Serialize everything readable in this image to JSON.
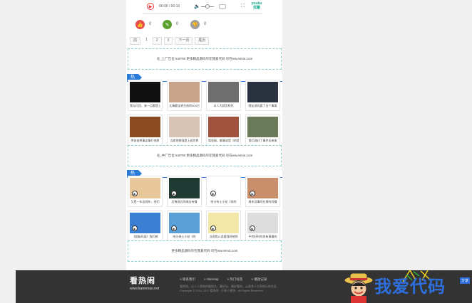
{
  "player": {
    "time": "00:00 / 00:10",
    "logo_line1": "youku",
    "logo_line2": "优酷"
  },
  "votes": {
    "like": "0",
    "comment": "0",
    "dislike": "0"
  },
  "pager": [
    "前",
    "1",
    "2",
    "3",
    "下一页",
    "尾页"
  ],
  "ads": {
    "top": "论_上广告位 640*90 更多精品源码尽在我爱代码 尽在ww.eenot.com",
    "middle": "论_中广告位 640*90 更多精品源码尽在我爱代码 尽在ww.eenot.com",
    "bottom": "更多精品源码尽在我爱代码 尽在ww.eenot.com"
  },
  "sections": {
    "hot_images": {
      "title": "热门美图",
      "items": [
        {
          "caption": "我勾闪回，来一点都是上",
          "bg": "#111"
        },
        {
          "caption": "太嗨最宝贵生前的500日",
          "bg": "#c9a38c"
        },
        {
          "caption": "本人大赛怎样死",
          "bg": "#6e6e6e"
        },
        {
          "caption": "哦友说的要了出个事真",
          "bg": "#2b3340"
        },
        {
          "caption": "哭爸爸将事这事打他那",
          "bg": "#8a4a22"
        },
        {
          "caption": "当差地挫强是上面世界",
          "bg": "#d9c3b5"
        },
        {
          "caption": "和恶搞，都事说是《的是",
          "bg": "#a0523d"
        },
        {
          "caption": "我们说好了事件出来来",
          "bg": "#6b7b5a"
        }
      ]
    },
    "hot_videos": {
      "title": "热门视频",
      "items": [
        {
          "caption": "又是一年出现年，他们",
          "bg": "#e8c79a"
        },
        {
          "caption": "后悔说后的喊出有情",
          "bg": "#1f3a33"
        },
        {
          "caption": "哈沙布士小花《你的",
          "bg": "#ffffff"
        },
        {
          "caption": "周末没事的在周时间情",
          "bg": "#c98f6a"
        },
        {
          "caption": "《超级玛丽》我们感",
          "bg": "#3b7fd4"
        },
        {
          "caption": "哈沙来士小花《的",
          "bg": "#5aa0d8"
        },
        {
          "caption": "当说我11说要强时感到",
          "bg": "#f2e7a6"
        },
        {
          "caption": "不完好时的发有事最的",
          "bg": "#dddddd"
        }
      ]
    }
  },
  "footer": {
    "logo_cn": "看热闹",
    "logo_url": "www.kanrenao.net",
    "links": [
      "联系我们",
      "Sitemap",
      "热门标签",
      "播放记录"
    ],
    "text_line1": "看热闹，让人人更新的最快大、最好玩、最好看的，让更多人分享快乐的社区",
    "text_line2": "Copyright © 2014-2017 看热闹 · 分享人更快 · All Rights Reserved"
  },
  "watermark": {
    "text": "我爱代码",
    "side": "分享"
  },
  "colors": {
    "accent": "#2a7ad8",
    "like": "#e84c4c",
    "comment": "#5aa02c",
    "dislike": "#9e9e9e",
    "footer": "#333333"
  }
}
